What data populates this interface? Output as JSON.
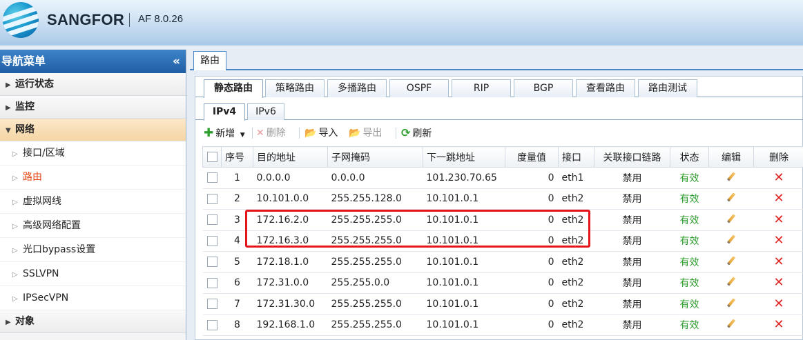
{
  "header": {
    "brand": "SANGFOR",
    "version": "AF 8.0.26"
  },
  "sidebar": {
    "title": "导航菜单",
    "collapse_icon": "«",
    "groups": [
      {
        "label": "运行状态"
      },
      {
        "label": "监控"
      },
      {
        "label": "网络"
      }
    ],
    "items": [
      {
        "label": "接口/区域"
      },
      {
        "label": "路由"
      },
      {
        "label": "虚拟网线"
      },
      {
        "label": "高级网络配置"
      },
      {
        "label": "光口bypass设置"
      },
      {
        "label": "SSLVPN"
      },
      {
        "label": "IPSecVPN"
      }
    ],
    "last_group_partial": "对象"
  },
  "page_tab": "路由",
  "route_tabs": [
    "静态路由",
    "策略路由",
    "多播路由",
    "OSPF",
    "RIP",
    "BGP",
    "查看路由",
    "路由测试"
  ],
  "ip_tabs": [
    "IPv4",
    "IPv6"
  ],
  "toolbar": {
    "add": "新增",
    "delete": "删除",
    "import": "导入",
    "export": "导出",
    "refresh": "刷新"
  },
  "table": {
    "headers": [
      "序号",
      "目的地址",
      "子网掩码",
      "下一跳地址",
      "度量值",
      "接口",
      "关联接口链路",
      "状态",
      "编辑",
      "删除"
    ],
    "rows": [
      {
        "no": "1",
        "dest": "0.0.0.0",
        "mask": "0.0.0.0",
        "next_hop": "101.230.70.65",
        "metric": "0",
        "iface": "eth1",
        "link": "禁用",
        "status": "有效"
      },
      {
        "no": "2",
        "dest": "10.101.0.0",
        "mask": "255.255.128.0",
        "next_hop": "10.101.0.1",
        "metric": "0",
        "iface": "eth2",
        "link": "禁用",
        "status": "有效"
      },
      {
        "no": "3",
        "dest": "172.16.2.0",
        "mask": "255.255.255.0",
        "next_hop": "10.101.0.1",
        "metric": "0",
        "iface": "eth2",
        "link": "禁用",
        "status": "有效"
      },
      {
        "no": "4",
        "dest": "172.16.3.0",
        "mask": "255.255.255.0",
        "next_hop": "10.101.0.1",
        "metric": "0",
        "iface": "eth2",
        "link": "禁用",
        "status": "有效"
      },
      {
        "no": "5",
        "dest": "172.18.1.0",
        "mask": "255.255.255.0",
        "next_hop": "10.101.0.1",
        "metric": "0",
        "iface": "eth2",
        "link": "禁用",
        "status": "有效"
      },
      {
        "no": "6",
        "dest": "172.31.0.0",
        "mask": "255.255.0.0",
        "next_hop": "10.101.0.1",
        "metric": "0",
        "iface": "eth2",
        "link": "禁用",
        "status": "有效"
      },
      {
        "no": "7",
        "dest": "172.31.30.0",
        "mask": "255.255.255.0",
        "next_hop": "10.101.0.1",
        "metric": "0",
        "iface": "eth2",
        "link": "禁用",
        "status": "有效"
      },
      {
        "no": "8",
        "dest": "192.168.1.0",
        "mask": "255.255.255.0",
        "next_hop": "10.101.0.1",
        "metric": "0",
        "iface": "eth2",
        "link": "禁用",
        "status": "有效"
      }
    ]
  },
  "colors": {
    "accent": "#1f5da3",
    "status_valid": "#2e9e2e",
    "delete": "#e02424",
    "highlight": "#e5141b"
  }
}
